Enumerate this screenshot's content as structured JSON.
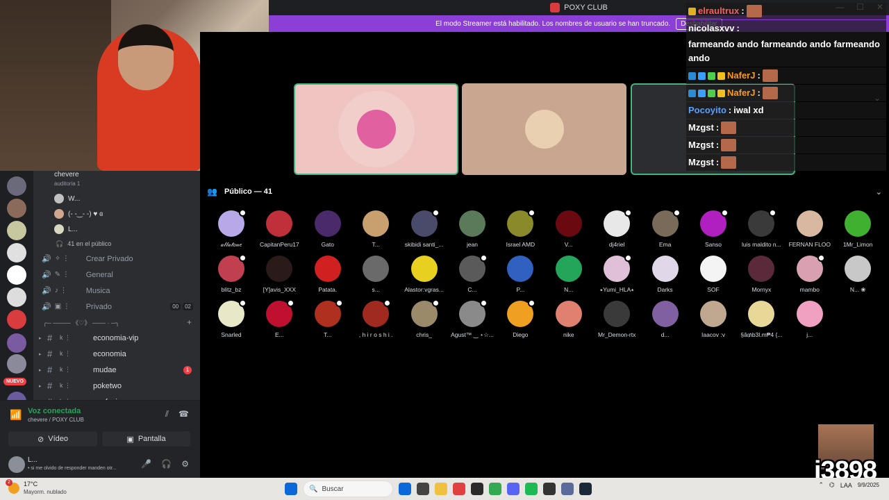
{
  "window": {
    "title": "POXY CLUB",
    "controls": [
      "—",
      "☐",
      "✕"
    ]
  },
  "banner": {
    "text": "El modo Streamer está habilitado. Los nombres de usuario se han truncado.",
    "button": "Deshabilitar"
  },
  "sidebar": {
    "voice_channel": {
      "name": "chevere",
      "subtitle": "auditoria 1",
      "users": [
        {
          "name": "W..."
        },
        {
          "name": "(- -‿- -) ♥ ɞ"
        },
        {
          "name": "L..."
        }
      ],
      "audience": "41 en el público"
    },
    "channels": [
      {
        "glyph": "✧ ⋮",
        "label": "Crear Privado"
      },
      {
        "glyph": "✎ ⋮",
        "label": "General"
      },
      {
        "glyph": "♪ ⋮",
        "label": "Musica"
      },
      {
        "glyph": "▣ ⋮",
        "label": "Privado",
        "pills": [
          "00",
          "02"
        ]
      }
    ],
    "category": "╭─ ──── 《♡》 ─── · ─╮",
    "text_channels": [
      {
        "emo": "k ⋮",
        "label": "economia-vip"
      },
      {
        "emo": "k ⋮",
        "label": "economia"
      },
      {
        "emo": "k ⋮",
        "label": "mudae",
        "badge": "1"
      },
      {
        "emo": "k ⋮",
        "label": "poketwo"
      },
      {
        "emo": "k ⋮",
        "label": "confesiones"
      }
    ],
    "new_badge": "NUEVO"
  },
  "voice_panel": {
    "status": "Voz conectada",
    "channel": "chevere / POXY CLUB",
    "video_label": "Vídeo",
    "screen_label": "Pantalla",
    "user": {
      "name": "L...",
      "status": "• si me olvido de responder manden otr..."
    }
  },
  "stream_chat": [
    {
      "user": "elraultrux",
      "color": "#ff5c5c",
      "text": "",
      "emote": true,
      "badges": [
        "#e0b020"
      ]
    },
    {
      "user": "nicolasxvv",
      "color": "#ffffff",
      "text": "farmeando ando farmeando ando farmeando ando",
      "badges": []
    },
    {
      "user": "NaferJ",
      "color": "#ff9a1a",
      "text": "",
      "emote": true,
      "badges": [
        "#2a8bd6",
        "#3aa0ff",
        "#4cd04c",
        "#f0c020"
      ]
    },
    {
      "user": "NaferJ",
      "color": "#ff9a1a",
      "text": "",
      "emote": true,
      "badges": [
        "#2a8bd6",
        "#3aa0ff",
        "#4cd04c",
        "#f0c020"
      ]
    },
    {
      "user": "Pocoyito",
      "color": "#5aa0ff",
      "text": "iwal xd",
      "badges": []
    },
    {
      "user": "Mzgst",
      "color": "#ffffff",
      "text": "",
      "emote": true,
      "badges": []
    },
    {
      "user": "Mzgst",
      "color": "#ffffff",
      "text": "",
      "emote": true,
      "badges": []
    },
    {
      "user": "Mzgst",
      "color": "#ffffff",
      "text": "",
      "emote": true,
      "badges": []
    }
  ],
  "audience": {
    "title": "Público — 41",
    "members": [
      {
        "name": "𝒶𝓁𝓁𝒶𝓉𝑜𝓃𝑒",
        "color": "#b8a8e8",
        "mod": true
      },
      {
        "name": "CapitanPeru17",
        "color": "#c0303a",
        "mod": false
      },
      {
        "name": "Gato",
        "color": "#4a2a6a",
        "mod": false
      },
      {
        "name": "T...",
        "color": "#c8a070",
        "mod": false
      },
      {
        "name": "skibidi santi_...",
        "color": "#4a4a6a",
        "mod": true
      },
      {
        "name": "jean",
        "color": "#5a7a5a",
        "mod": false
      },
      {
        "name": "Israel AMD",
        "color": "#8a8a2a",
        "mod": true
      },
      {
        "name": "V...",
        "color": "#6a0a10",
        "mod": false
      },
      {
        "name": "dj4riel",
        "color": "#e8e8e8",
        "mod": true
      },
      {
        "name": "Ema",
        "color": "#7a6a5a",
        "mod": true
      },
      {
        "name": "Sanso",
        "color": "#b020c0",
        "mod": true
      },
      {
        "name": "luis maldito n...",
        "color": "#3a3a3a",
        "mod": true
      },
      {
        "name": "FERNAN FLOO",
        "color": "#d8b8a0",
        "mod": false
      },
      {
        "name": "1Mr_Limon",
        "color": "#40b030",
        "mod": false
      },
      {
        "name": "blitz_bz",
        "color": "#c04050",
        "mod": true
      },
      {
        "name": "[Y]avis_XXX",
        "color": "#2a1a1a",
        "mod": false
      },
      {
        "name": "Patata.",
        "color": "#d02020",
        "mod": false
      },
      {
        "name": "s...",
        "color": "#6a6a6a",
        "mod": false
      },
      {
        "name": "Alastor:vgras...",
        "color": "#e8d020",
        "mod": false
      },
      {
        "name": "C...",
        "color": "#5a5a5a",
        "mod": true
      },
      {
        "name": "P...",
        "color": "#3060c0",
        "mod": false
      },
      {
        "name": "N...",
        "color": "#23a55a",
        "mod": false
      },
      {
        "name": "⭑Yumi_HLA⭑",
        "color": "#e0c0d8",
        "mod": true
      },
      {
        "name": "Darks",
        "color": "#e0d8e8",
        "mod": false
      },
      {
        "name": "SOF",
        "color": "#f4f4f4",
        "mod": false
      },
      {
        "name": "Mornyx",
        "color": "#5a2a3a",
        "mod": false
      },
      {
        "name": "mambo",
        "color": "#d8a0b0",
        "mod": true
      },
      {
        "name": "N... ❀",
        "color": "#c8c8c8",
        "mod": false
      },
      {
        "name": "Snarled",
        "color": "#e8e8c8",
        "mod": true
      },
      {
        "name": "E...",
        "color": "#c01030",
        "mod": true
      },
      {
        "name": "T...",
        "color": "#b03020",
        "mod": true
      },
      {
        "name": ", h i r o s h i .",
        "color": "#a02a20",
        "mod": true
      },
      {
        "name": "chris_",
        "color": "#9a8a6a",
        "mod": true
      },
      {
        "name": "Agust™ ‿ ⋆☆...",
        "color": "#8a8a8a",
        "mod": true
      },
      {
        "name": "Diego",
        "color": "#f0a020",
        "mod": true
      },
      {
        "name": "nike",
        "color": "#e08070",
        "mod": false
      },
      {
        "name": "Mr_Demon-rtx",
        "color": "#3a3a3a",
        "mod": false
      },
      {
        "name": "d...",
        "color": "#8060a0",
        "mod": false
      },
      {
        "name": "Iaacov :v",
        "color": "#c0a890",
        "mod": false
      },
      {
        "name": "§â₥b3l.m₱4 {...",
        "color": "#e8d898",
        "mod": false
      },
      {
        "name": "j...",
        "color": "#f0a0c0",
        "mod": false
      }
    ]
  },
  "stage_tiles": [
    {
      "bg": "#f0c4c0",
      "border": "#43b581",
      "avatar": "#e060a0"
    },
    {
      "bg": "#c8a690",
      "border": "#c8a690",
      "avatar": "#e8d0b0"
    },
    {
      "bg": "#2b2d31",
      "border": "#43b581",
      "avatar": "#555"
    }
  ],
  "corner_counter": "i3898",
  "taskbar": {
    "weather_temp": "17°C",
    "weather_desc": "Mayorm. nublado",
    "weather_badge": "2",
    "search_placeholder": "Buscar",
    "lang": "LAA",
    "date": "9/9/2025",
    "icons": [
      "#0a68d8",
      "#444",
      "#f0c040",
      "#e04040",
      "#2a2a2a",
      "#34a853",
      "#5865f2",
      "#1db954",
      "#333",
      "#5a6a9a",
      "#1b2838"
    ]
  }
}
